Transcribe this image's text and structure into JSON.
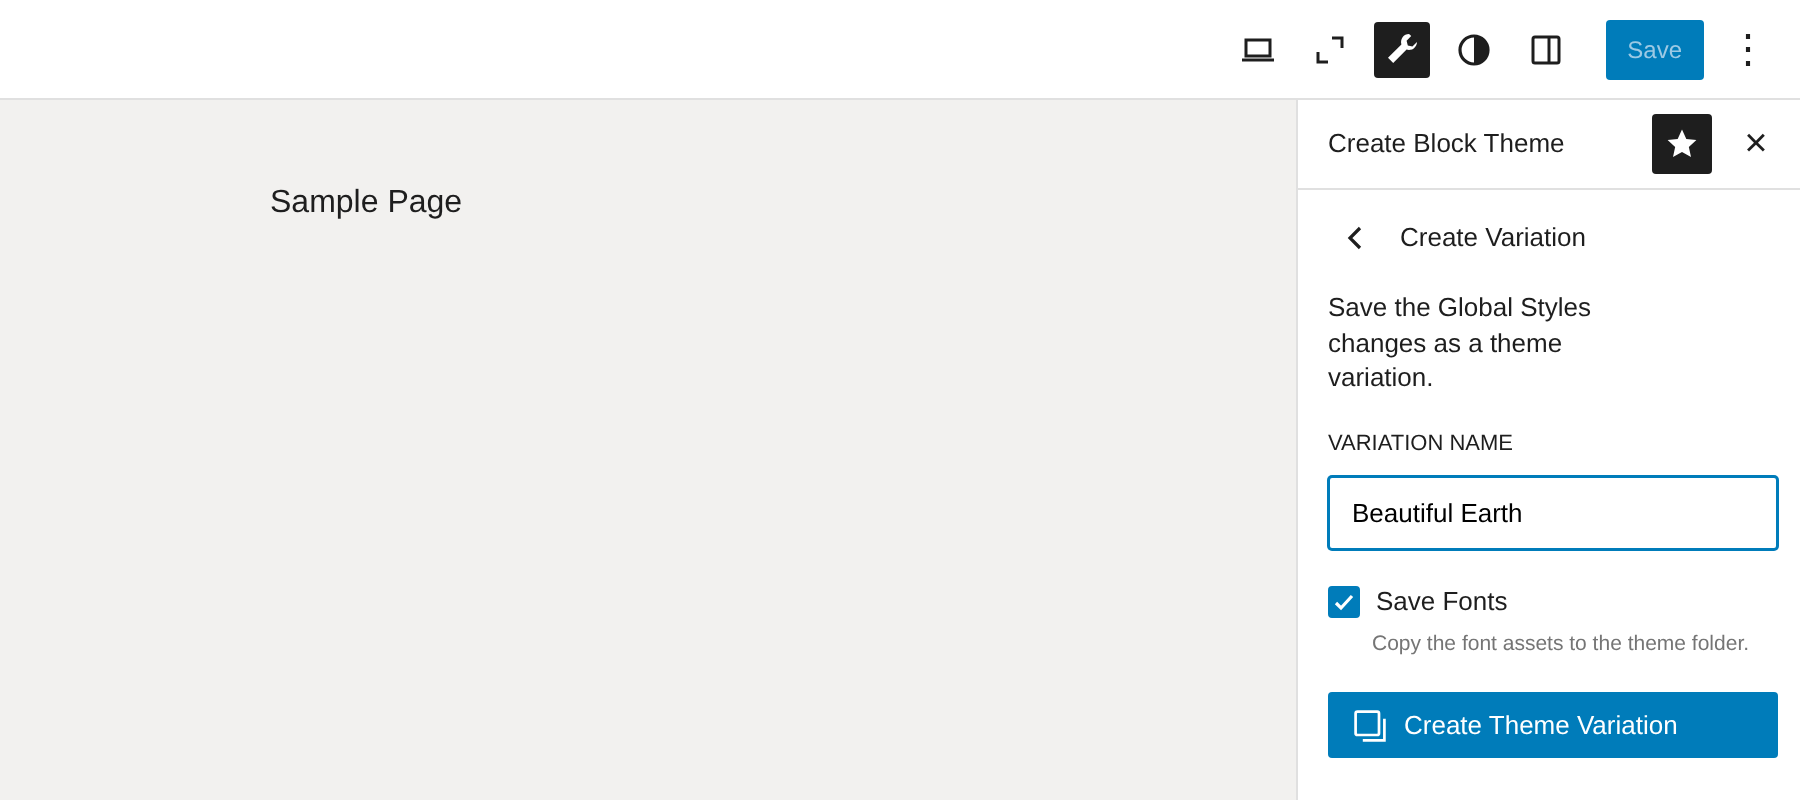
{
  "toolbar": {
    "tools": [
      {
        "kind": "device",
        "selected": false
      },
      {
        "kind": "fullscreen",
        "selected": false
      },
      {
        "kind": "tools",
        "selected": true
      },
      {
        "kind": "styles",
        "selected": false
      },
      {
        "kind": "settings",
        "selected": false
      }
    ],
    "save": {
      "label": "Save",
      "disabled": true
    },
    "more": {
      "label": "⋮"
    }
  },
  "canvas": {
    "title": "Sample Page"
  },
  "sidebar": {
    "title": "Create Block Theme",
    "pin": {
      "selected": true
    },
    "close": {
      "label": "×"
    },
    "back": {
      "label": "Create Variation"
    },
    "description": "Save the Global Styles changes as a theme variation.",
    "field": {
      "label": "VARIATION NAME",
      "value": "Beautiful Earth"
    },
    "checkbox": {
      "label": "Save Fonts",
      "checked": true,
      "help": "Copy the font assets to the theme folder."
    },
    "action": {
      "label": "Create Theme Variation"
    }
  }
}
